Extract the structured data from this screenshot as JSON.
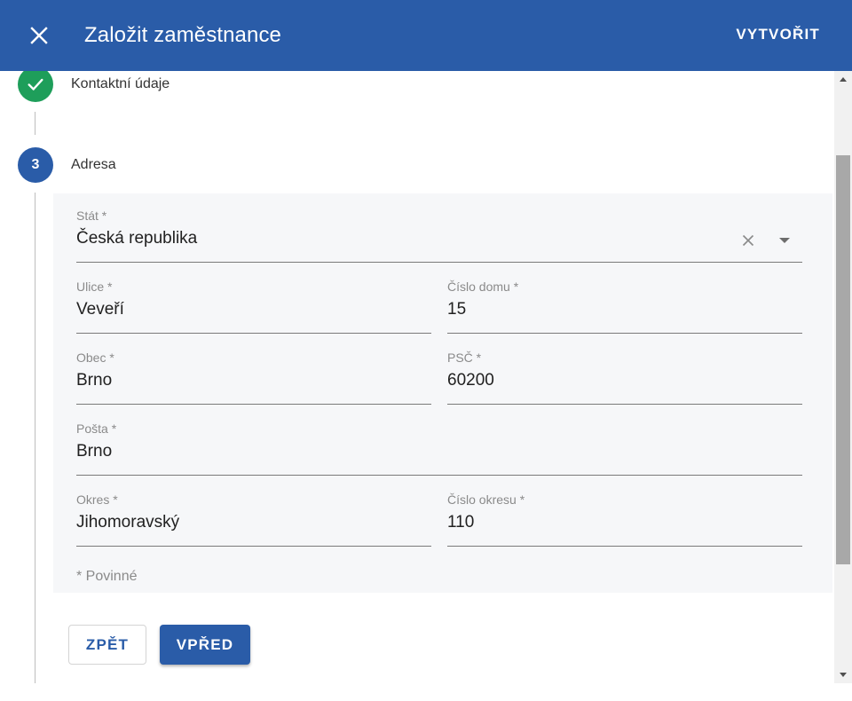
{
  "header": {
    "title": "Založit zaměstnance",
    "create_label": "VYTVOŘIT",
    "background": "#2a5ca8"
  },
  "steps": [
    {
      "label": "Kontaktní údaje",
      "status": "done",
      "icon": "check-icon",
      "color": "#1e9e5a"
    },
    {
      "number": "3",
      "label": "Adresa",
      "status": "active",
      "color": "#2a5ca8"
    }
  ],
  "form": {
    "country": {
      "label": "Stát *",
      "value": "Česká republika"
    },
    "street": {
      "label": "Ulice *",
      "value": "Veveří"
    },
    "house_number": {
      "label": "Číslo domu *",
      "value": "15"
    },
    "municipality": {
      "label": "Obec *",
      "value": "Brno"
    },
    "zip": {
      "label": "PSČ *",
      "value": "60200"
    },
    "post_office": {
      "label": "Pošta *",
      "value": "Brno"
    },
    "district": {
      "label": "Okres *",
      "value": "Jihomoravský"
    },
    "district_number": {
      "label": "Číslo okresu *",
      "value": "110"
    },
    "required_note": "* Povinné"
  },
  "buttons": {
    "back_label": "ZPĚT",
    "next_label": "VPŘED"
  }
}
